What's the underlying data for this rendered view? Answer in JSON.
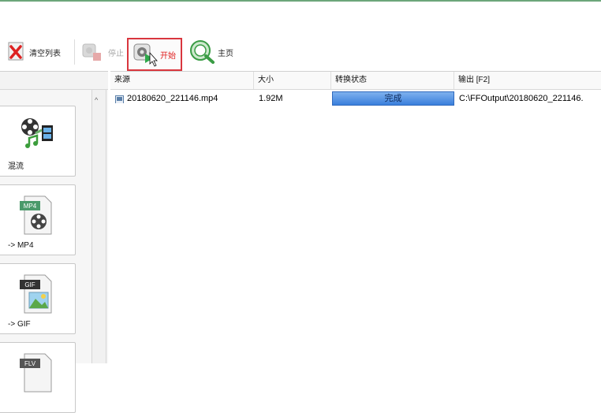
{
  "toolbar": {
    "clear_label": "清空列表",
    "stop_label": "停止",
    "start_label": "开始",
    "home_label": "主页"
  },
  "sidebar": {
    "cards": [
      {
        "label": "混流",
        "icon": "film-reel-music-icon"
      },
      {
        "label": "-> MP4",
        "icon": "mp4-file-icon",
        "badge": "MP4"
      },
      {
        "label": "-> GIF",
        "icon": "gif-file-icon",
        "badge": "GIF"
      },
      {
        "label": "",
        "icon": "flv-file-icon",
        "badge": "FLV"
      }
    ]
  },
  "table": {
    "columns": [
      "来源",
      "大小",
      "转换状态",
      "输出 [F2]"
    ],
    "rows": [
      {
        "source": "20180620_221146.mp4",
        "size": "1.92M",
        "status": "完成",
        "output": "C:\\FFOutput\\20180620_221146.",
        "progress": 1.0
      }
    ]
  },
  "colors": {
    "accent_red": "#d9363e",
    "progress_blue": "#3a7fdc",
    "top_line": "#6ca67a"
  }
}
